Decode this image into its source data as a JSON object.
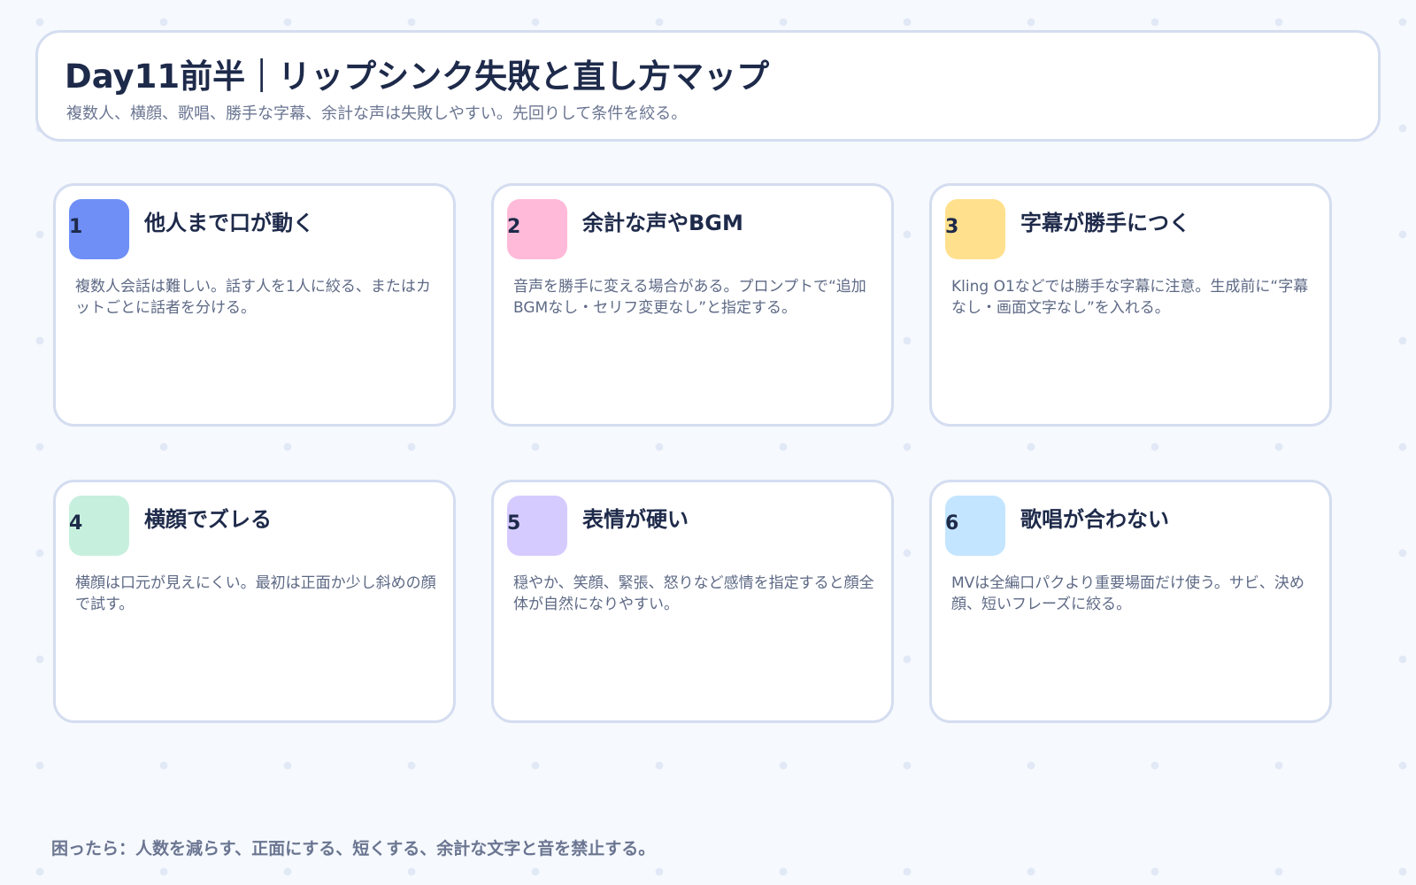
{
  "header": {
    "title": "Day11前半｜リップシンク失敗と直し方マップ",
    "subtitle": "複数人、横顔、歌唱、勝手な字幕、余計な声は失敗しやすい。先回りして条件を絞る。"
  },
  "cards": [
    {
      "number": "1",
      "title": "他人まで口が動く",
      "description": "複数人会話は難しい。話す人を1人に絞る、またはカットごとに話者を分ける。",
      "badge_color": "#6f8ff7"
    },
    {
      "number": "2",
      "title": "余計な声やBGM",
      "description": "音声を勝手に変える場合がある。プロンプトで“追加BGMなし・セリフ変更なし”と指定する。",
      "badge_color": "#ffbad9"
    },
    {
      "number": "3",
      "title": "字幕が勝手につく",
      "description": "Kling O1などでは勝手な字幕に注意。生成前に“字幕なし・画面文字なし”を入れる。",
      "badge_color": "#ffe08c"
    },
    {
      "number": "4",
      "title": "横顔でズレる",
      "description": "横顔は口元が見えにくい。最初は正面か少し斜めの顔で試す。",
      "badge_color": "#c6f0dd"
    },
    {
      "number": "5",
      "title": "表情が硬い",
      "description": "穏やか、笑顔、緊張、怒りなど感情を指定すると顔全体が自然になりやすい。",
      "badge_color": "#d6cbff"
    },
    {
      "number": "6",
      "title": "歌唱が合わない",
      "description": "MVは全編口パクより重要場面だけ使う。サビ、決め顔、短いフレーズに絞る。",
      "badge_color": "#c4e5ff"
    }
  ],
  "footer": {
    "text": "困ったら：人数を減らす、正面にする、短くする、余計な文字と音を禁止する。"
  }
}
